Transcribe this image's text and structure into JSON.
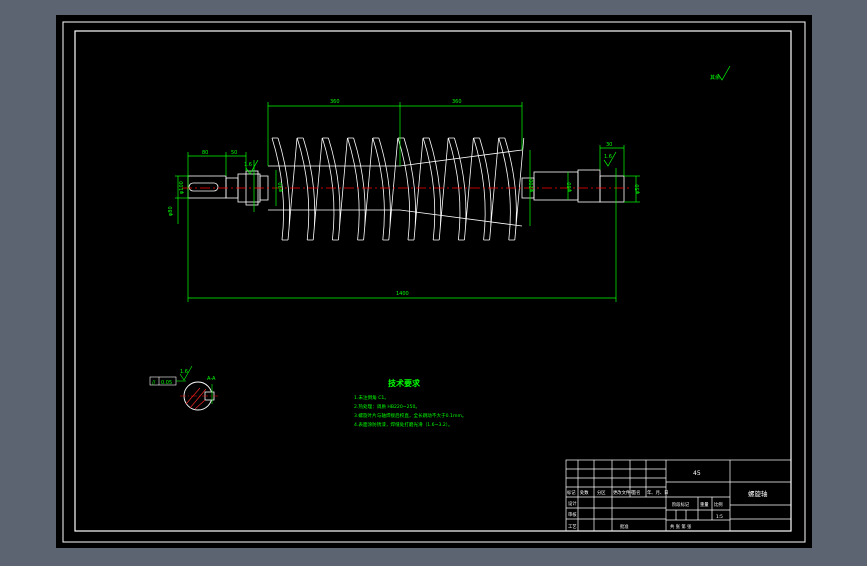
{
  "colors": {
    "workspace": "#5b6470",
    "sheet": "#000000",
    "frame": "#ffffff",
    "dimension": "#00ff00",
    "centerline": "#ff0000",
    "title_text": "#ffffff"
  },
  "drawing": {
    "roughness_note": "其余",
    "dims": {
      "left_length": "360",
      "right_length": "360",
      "total_length": "1400",
      "shaft_left_1": "80",
      "shaft_left_2": "50",
      "shaft_right_1": "30",
      "flange_dim": "φ80",
      "shaft_dia_left": "φ60",
      "shaft_dia_mid": "φ90",
      "shaft_dia_right": "φ60",
      "end_dia_right": "φ50",
      "auger_dia": "φ200",
      "left_height": "φ100",
      "right_roughness": "1.6",
      "left_roughness": "1.6"
    },
    "section": {
      "tolerance_symbol": "//",
      "tolerance_value": "0.05",
      "label": "A-A",
      "roughness": "1.6"
    },
    "technical_requirements": {
      "title": "技术要求",
      "items": [
        "1.未注倒角 C1。",
        "2.热处理：调质 HB220~250。",
        "3.螺旋叶片与轴焊接后校直，全长跳动不大于0.1mm。",
        "4.表面涂防锈漆，焊缝处打磨光滑（1.6~3.2）。"
      ]
    }
  },
  "title_block": {
    "material": "45",
    "drawing_name": "螺旋轴",
    "row_labels": [
      "标记",
      "处数",
      "分区",
      "更改文件号",
      "签名",
      "年、月、日"
    ],
    "left_labels": [
      "设计",
      "审核",
      "工艺"
    ],
    "stage_label": "阶段标记",
    "weight_label": "重量",
    "scale_label": "比例",
    "scale_value": "1:5",
    "sheet_label": "共  张  第  张",
    "approve_label": "批准"
  }
}
